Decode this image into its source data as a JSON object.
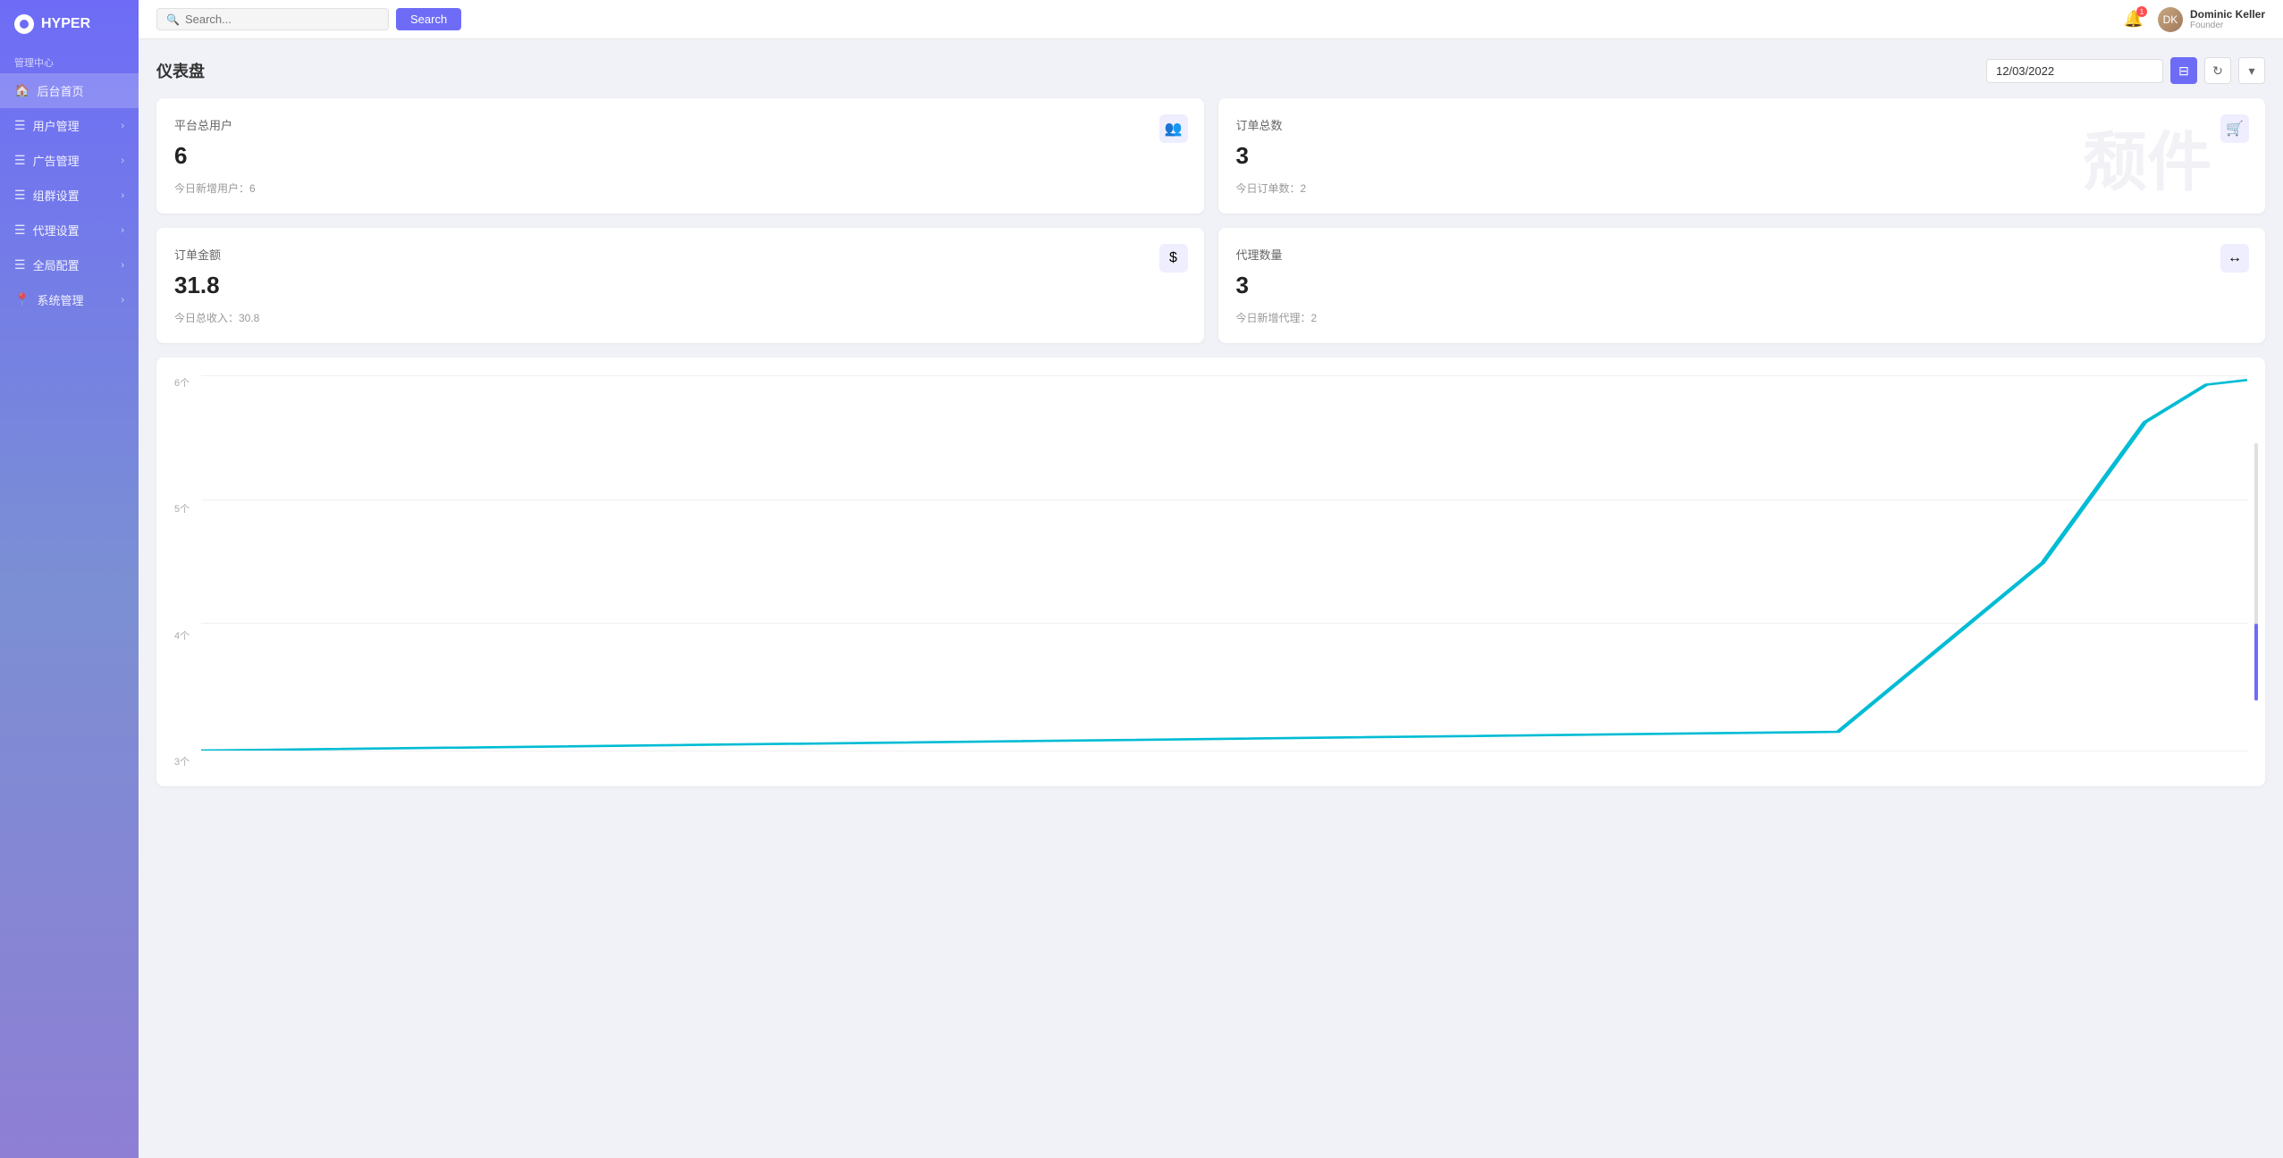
{
  "app": {
    "name": "HYPER"
  },
  "sidebar": {
    "section_label": "管理中心",
    "items": [
      {
        "id": "home",
        "label": "后台首页",
        "icon": "🏠",
        "has_arrow": false,
        "active": true
      },
      {
        "id": "users",
        "label": "用户管理",
        "icon": "☰",
        "has_arrow": true
      },
      {
        "id": "ads",
        "label": "广告管理",
        "icon": "☰",
        "has_arrow": true
      },
      {
        "id": "groups",
        "label": "组群设置",
        "icon": "☰",
        "has_arrow": true
      },
      {
        "id": "agents",
        "label": "代理设置",
        "icon": "☰",
        "has_arrow": true
      },
      {
        "id": "global",
        "label": "全局配置",
        "icon": "☰",
        "has_arrow": true
      },
      {
        "id": "system",
        "label": "系统管理",
        "icon": "📍",
        "has_arrow": true
      }
    ]
  },
  "header": {
    "search_placeholder": "Search...",
    "search_btn_label": "Search",
    "user": {
      "name": "Dominic Keller",
      "role": "Founder"
    }
  },
  "dashboard": {
    "title": "仪表盘",
    "date": "12/03/2022",
    "stats": [
      {
        "label": "平台总用户",
        "value": "6",
        "sub": "今日新增用户：6",
        "icon": "👥",
        "watermark": ""
      },
      {
        "label": "订单总数",
        "value": "3",
        "sub": "今日订单数：2",
        "icon": "🛒",
        "watermark": "颓件"
      },
      {
        "label": "订单金额",
        "value": "31.8",
        "sub": "今日总收入：30.8",
        "icon": "$",
        "watermark": ""
      },
      {
        "label": "代理数量",
        "value": "3",
        "sub": "今日新增代理：2",
        "icon": "↔",
        "watermark": ""
      }
    ],
    "chart": {
      "y_labels": [
        "6个",
        "5个",
        "4个",
        "3个"
      ],
      "line_color": "#00bcd4"
    }
  }
}
